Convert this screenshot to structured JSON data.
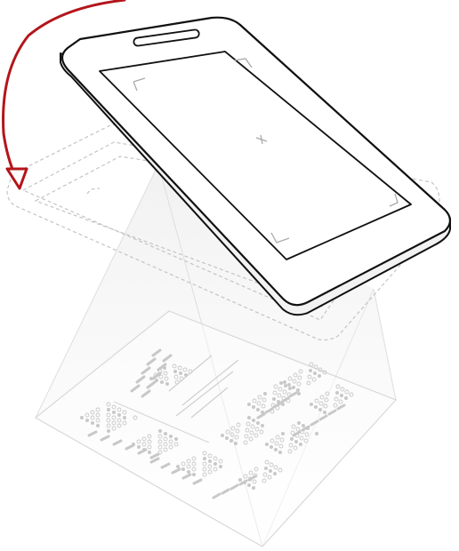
{
  "illustration": {
    "subject": "phone-scanning-printed-page",
    "arrow_color": "#b3151b",
    "outline_color": "#111111",
    "dashed_color": "#c4c4c4",
    "page_color": "#dddddd",
    "text_color": "#c8c8c8",
    "screen_marks": [
      "corner-bracket-icon",
      "crosshair-icon"
    ]
  }
}
